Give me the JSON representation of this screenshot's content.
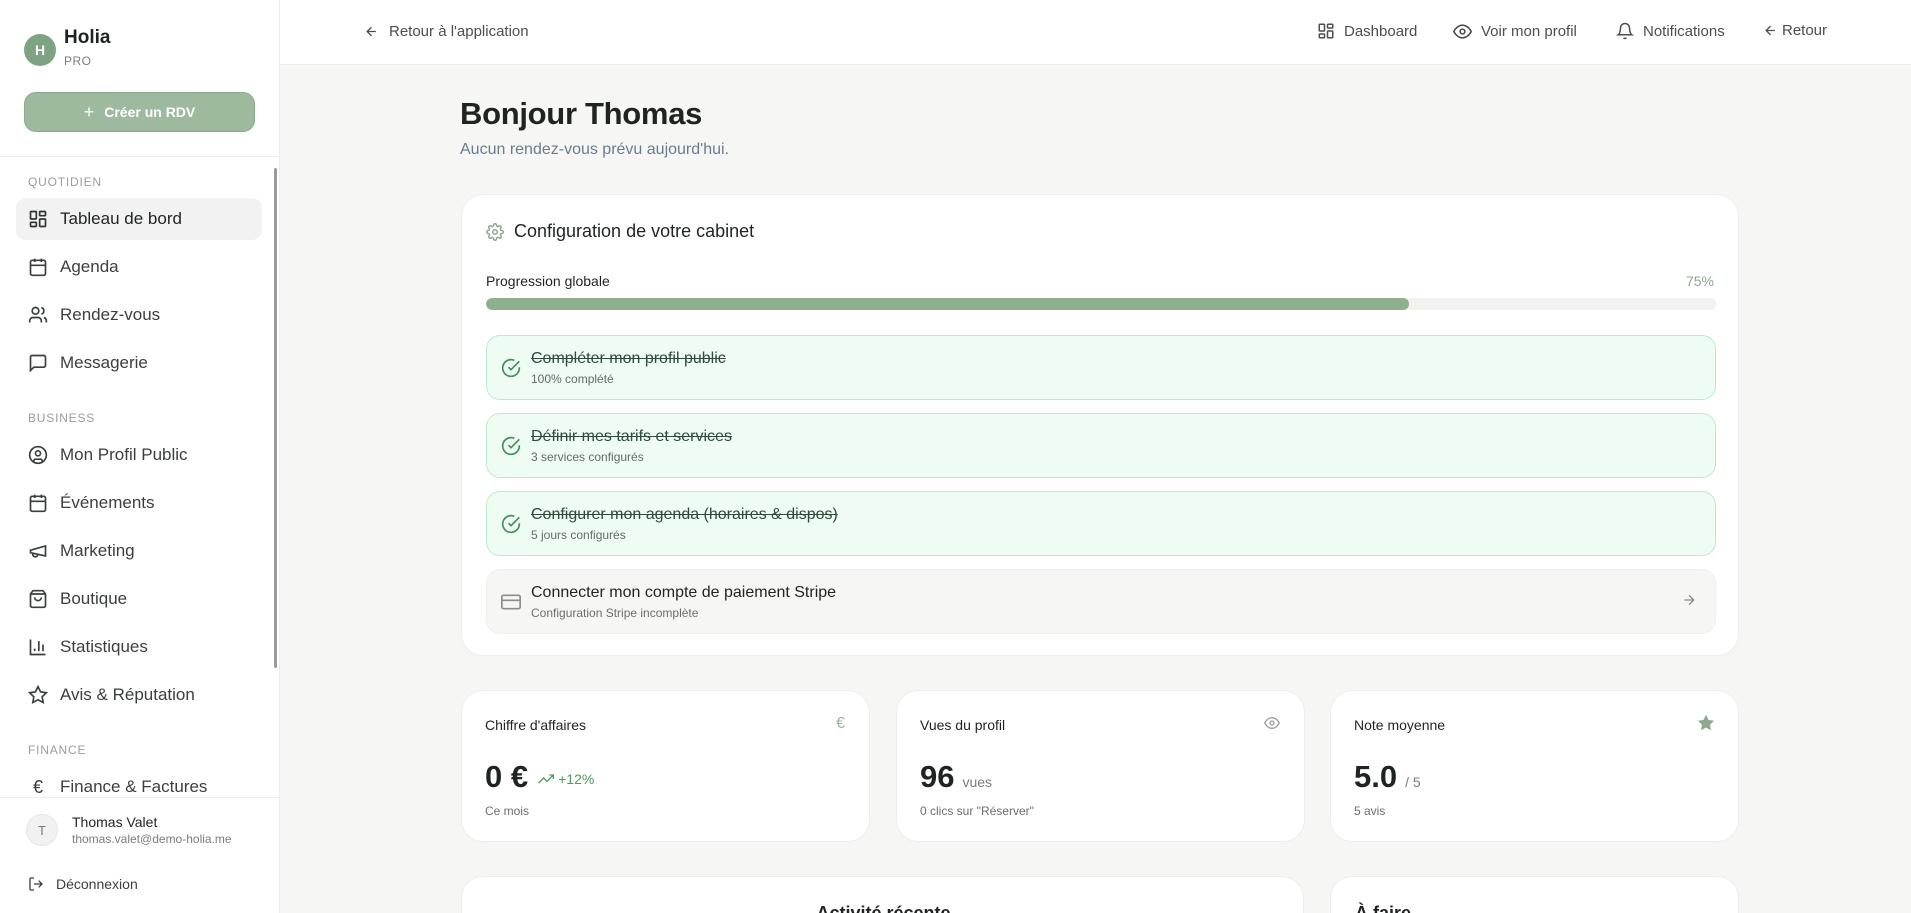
{
  "sidebar": {
    "brand": {
      "initial": "H",
      "name": "Holia",
      "plan": "PRO"
    },
    "create_button": "Créer un RDV",
    "sections": {
      "daily": "QUOTIDIEN",
      "business": "BUSINESS",
      "finance": "FINANCE"
    },
    "items": [
      {
        "label": "Tableau de bord",
        "icon": "dashboard-icon",
        "active": true
      },
      {
        "label": "Agenda",
        "icon": "calendar-icon"
      },
      {
        "label": "Rendez-vous",
        "icon": "users-icon"
      },
      {
        "label": "Messagerie",
        "icon": "message-icon"
      },
      {
        "label": "Mon Profil Public",
        "icon": "user-circle-icon"
      },
      {
        "label": "Événements",
        "icon": "calendar-days-icon"
      },
      {
        "label": "Marketing",
        "icon": "megaphone-icon"
      },
      {
        "label": "Boutique",
        "icon": "shopping-bag-icon"
      },
      {
        "label": "Statistiques",
        "icon": "bar-chart-icon"
      },
      {
        "label": "Avis & Réputation",
        "icon": "star-icon"
      },
      {
        "label": "Finance & Factures",
        "icon": "euro-icon"
      }
    ],
    "user": {
      "initial": "T",
      "name": "Thomas Valet",
      "email": "thomas.valet@demo-holia.me"
    },
    "logout": "Déconnexion"
  },
  "topbar": {
    "back_to_app": "Retour à l'application",
    "links": {
      "dashboard": "Dashboard",
      "profile": "Voir mon profil",
      "notifications": "Notifications",
      "back": "Retour"
    }
  },
  "main": {
    "greeting": "Bonjour Thomas",
    "subgreeting": "Aucun rendez-vous prévu aujourd'hui.",
    "config": {
      "title": "Configuration de votre cabinet",
      "progress_label": "Progression globale",
      "progress_percent": "75%",
      "progress_value": 0.75,
      "tasks": [
        {
          "title": "Compléter mon profil public",
          "sub": "100% complété",
          "done": true
        },
        {
          "title": "Définir mes tarifs et services",
          "sub": "3 services configurés",
          "done": true
        },
        {
          "title": "Configurer mon agenda (horaires & dispos)",
          "sub": "5 jours configurés",
          "done": true
        },
        {
          "title": "Connecter mon compte de paiement Stripe",
          "sub": "Configuration Stripe incomplète",
          "done": false
        }
      ]
    },
    "stats": {
      "revenue": {
        "label": "Chiffre d'affaires",
        "value": "0 €",
        "trend": "+12%",
        "foot": "Ce mois",
        "icon": "euro-icon"
      },
      "views": {
        "label": "Vues du profil",
        "value": "96",
        "unit": "vues",
        "foot": "0 clics sur \"Réserver\"",
        "icon": "eye-icon"
      },
      "rating": {
        "label": "Note moyenne",
        "value": "5.0",
        "unit": "/ 5",
        "foot": "5 avis",
        "icon": "star-filled-icon"
      }
    },
    "activity_title": "Activité récente",
    "todo_title": "À faire"
  },
  "colors": {
    "accent": "#8fb08f",
    "done_bg": "#effcf3",
    "done_border": "#b7eec7",
    "text": "#1f2421"
  }
}
